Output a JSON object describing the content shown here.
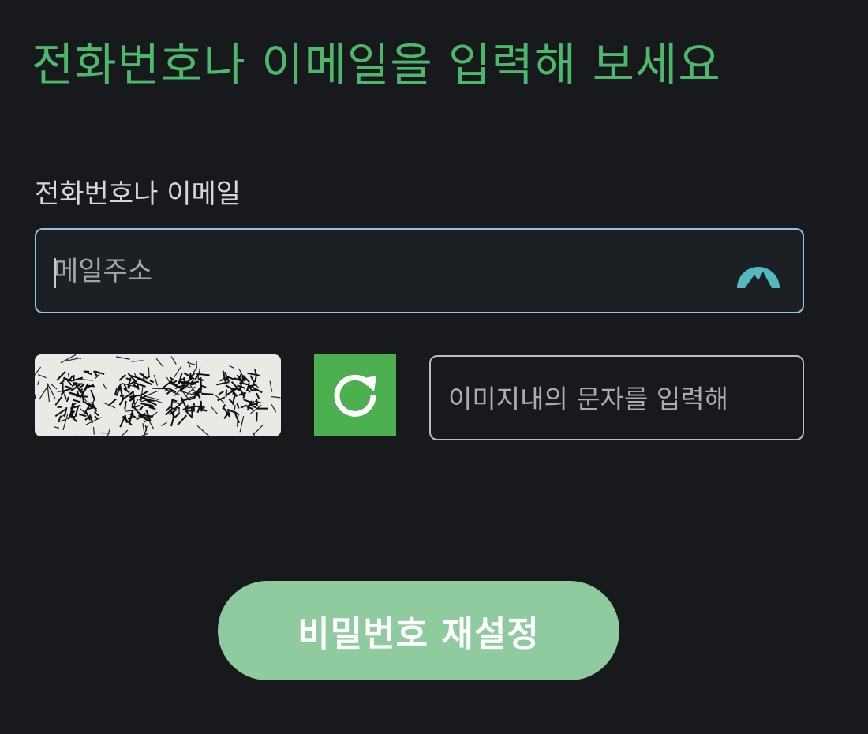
{
  "colors": {
    "accent": "#4cb96a",
    "button_bg": "#8fcb9f",
    "refresh_bg": "#4caf50",
    "focus_border": "#8ec3e6"
  },
  "heading": "전화번호나 이메일을 입력해 보세요",
  "id_field": {
    "label": "전화번호나 이메일",
    "placeholder": "메일주소",
    "autofill_icon": "password-manager-icon"
  },
  "captcha": {
    "image_icon": "captcha-image",
    "refresh_icon": "refresh-icon",
    "placeholder": "이미지내의 문자를 입력해"
  },
  "submit": {
    "label": "비밀번호 재설정"
  }
}
